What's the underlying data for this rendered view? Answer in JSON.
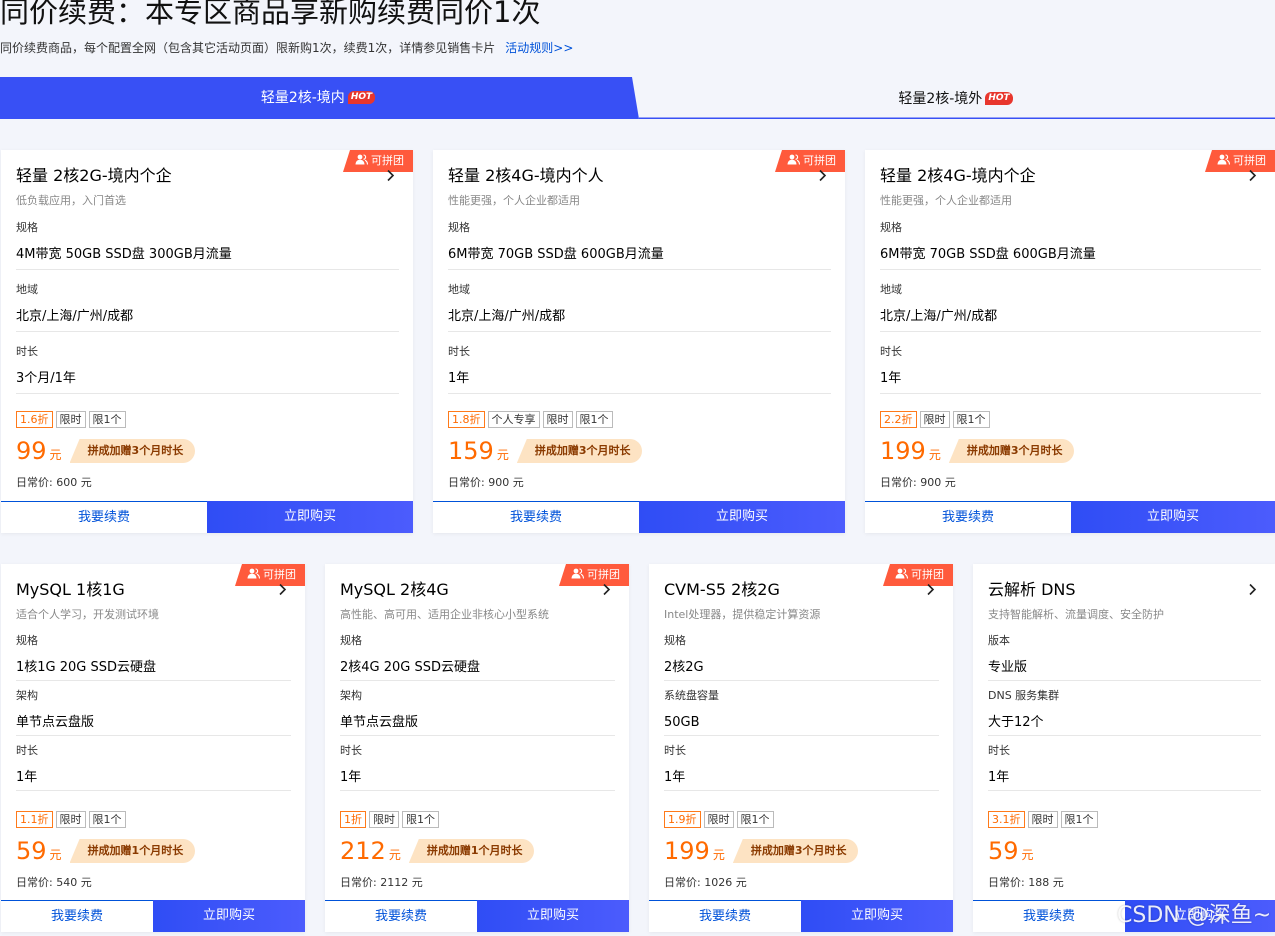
{
  "header": {
    "title": "同价续费：本专区商品享新购续费同价1次",
    "description": "同价续费商品，每个配置全网（包含其它活动页面）限新购1次，续费1次，详情参见销售卡片",
    "rules_link": "活动规则>>"
  },
  "tabs": [
    {
      "label": "轻量2核-境内",
      "badge": "HOT",
      "active": true
    },
    {
      "label": "轻量2核-境外",
      "badge": "HOT",
      "active": false
    }
  ],
  "colors": {
    "accent": "#2f4df5",
    "price": "#ff6a00",
    "badge": "#ff5a3c",
    "link": "#0052d9"
  },
  "badge_label": "可拼团",
  "renew_label": "我要续费",
  "buy_label": "立即购买",
  "cards": [
    {
      "title": "轻量 2核2G-境内个企",
      "subtitle": "低负载应用，入门首选",
      "specs": [
        {
          "label": "规格",
          "value": "4M带宽 50GB SSD盘 300GB月流量"
        },
        {
          "label": "地域",
          "value": "北京/上海/广州/成都"
        },
        {
          "label": "时长",
          "value": "3个月/1年"
        }
      ],
      "tags": [
        "1.6折",
        "限时",
        "限1个"
      ],
      "price": "99",
      "unit": "元",
      "promo": "拼成加赠3个月时长",
      "normal_price": "日常价: 600 元"
    },
    {
      "title": "轻量 2核4G-境内个人",
      "subtitle": "性能更强，个人企业都适用",
      "specs": [
        {
          "label": "规格",
          "value": "6M带宽 70GB SSD盘 600GB月流量"
        },
        {
          "label": "地域",
          "value": "北京/上海/广州/成都"
        },
        {
          "label": "时长",
          "value": "1年"
        }
      ],
      "tags": [
        "1.8折",
        "个人专享",
        "限时",
        "限1个"
      ],
      "price": "159",
      "unit": "元",
      "promo": "拼成加赠3个月时长",
      "normal_price": "日常价: 900 元"
    },
    {
      "title": "轻量 2核4G-境内个企",
      "subtitle": "性能更强，个人企业都适用",
      "specs": [
        {
          "label": "规格",
          "value": "6M带宽 70GB SSD盘 600GB月流量"
        },
        {
          "label": "地域",
          "value": "北京/上海/广州/成都"
        },
        {
          "label": "时长",
          "value": "1年"
        }
      ],
      "tags": [
        "2.2折",
        "限时",
        "限1个"
      ],
      "price": "199",
      "unit": "元",
      "promo": "拼成加赠3个月时长",
      "normal_price": "日常价: 900 元"
    },
    {
      "title": "MySQL 1核1G",
      "subtitle": "适合个人学习，开发测试环境",
      "specs": [
        {
          "label": "规格",
          "value": "1核1G 20G SSD云硬盘"
        },
        {
          "label": "架构",
          "value": "单节点云盘版"
        },
        {
          "label": "时长",
          "value": "1年"
        }
      ],
      "tags": [
        "1.1折",
        "限时",
        "限1个"
      ],
      "price": "59",
      "unit": "元",
      "promo": "拼成加赠1个月时长",
      "normal_price": "日常价: 540 元"
    },
    {
      "title": "MySQL 2核4G",
      "subtitle": "高性能、高可用、适用企业非核心小型系统",
      "specs": [
        {
          "label": "规格",
          "value": "2核4G 20G SSD云硬盘"
        },
        {
          "label": "架构",
          "value": "单节点云盘版"
        },
        {
          "label": "时长",
          "value": "1年"
        }
      ],
      "tags": [
        "1折",
        "限时",
        "限1个"
      ],
      "price": "212",
      "unit": "元",
      "promo": "拼成加赠1个月时长",
      "normal_price": "日常价: 2112 元"
    },
    {
      "title": "CVM-S5 2核2G",
      "subtitle": "Intel处理器，提供稳定计算资源",
      "specs": [
        {
          "label": "规格",
          "value": "2核2G"
        },
        {
          "label": "系统盘容量",
          "value": "50GB"
        },
        {
          "label": "时长",
          "value": "1年"
        }
      ],
      "tags": [
        "1.9折",
        "限时",
        "限1个"
      ],
      "price": "199",
      "unit": "元",
      "promo": "拼成加赠3个月时长",
      "normal_price": "日常价: 1026 元"
    },
    {
      "title": "云解析 DNS",
      "subtitle": "支持智能解析、流量调度、安全防护",
      "specs": [
        {
          "label": "版本",
          "value": "专业版"
        },
        {
          "label": "DNS 服务集群",
          "value": "大于12个"
        },
        {
          "label": "时长",
          "value": "1年"
        }
      ],
      "tags": [
        "3.1折",
        "限时",
        "限1个"
      ],
      "price": "59",
      "unit": "元",
      "promo": "",
      "normal_price": "日常价: 188 元"
    }
  ],
  "watermark": "CSDN @深鱼~"
}
